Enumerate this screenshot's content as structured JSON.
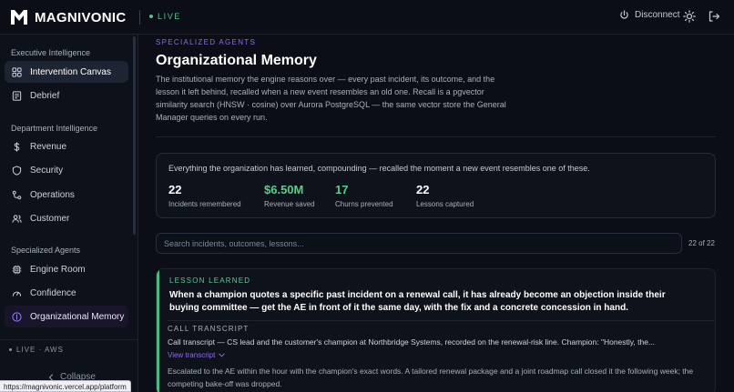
{
  "app": {
    "brand": "MAGNIVONIC",
    "live_label": "LIVE"
  },
  "header": {
    "disconnect_label": "Disconnect"
  },
  "sidebar": {
    "groups": [
      {
        "label": "Executive Intelligence",
        "items": [
          "Intervention Canvas",
          "Debrief"
        ]
      },
      {
        "label": "Department Intelligence",
        "items": [
          "Revenue",
          "Security",
          "Operations",
          "Customer"
        ]
      },
      {
        "label": "Specialized Agents",
        "items": [
          "Engine Room",
          "Confidence",
          "Organizational Memory"
        ]
      }
    ],
    "footer_live": "LIVE · AWS",
    "collapse_label": "Collapse"
  },
  "status_url": "https://magnivonic.vercel.app/platform",
  "page": {
    "eyebrow": "SPECIALIZED AGENTS",
    "title": "Organizational Memory",
    "description": "The institutional memory the engine reasons over — every past incident, its outcome, and the lesson it left behind, recalled when a new event resembles an old one. Recall is a pgvector similarity search (HNSW · cosine) over Aurora PostgreSQL — the same vector store the General Manager queries on every run."
  },
  "stats": {
    "caption": "Everything the organization has learned, compounding — recalled the moment a new event resembles one of these.",
    "items": [
      {
        "value": "22",
        "label": "Incidents remembered"
      },
      {
        "value": "$6.50M",
        "label": "Revenue saved"
      },
      {
        "value": "17",
        "label": "Churns prevented"
      },
      {
        "value": "22",
        "label": "Lessons captured"
      }
    ]
  },
  "search": {
    "placeholder": "Search incidents, outcomes, lessons...",
    "count": "22 of 22"
  },
  "lesson": {
    "tag": "LESSON LEARNED",
    "text": "When a champion quotes a specific past incident on a renewal call, it has already become an objection inside their buying committee — get the AE in front of it the same day, with the fix and a concrete concession in hand.",
    "call_tag": "CALL TRANSCRIPT",
    "call_text": "Call transcript — CS lead and the customer's champion at Northbridge Systems, recorded on the renewal-risk line. Champion: \"Honestly, the...",
    "view_label": "View transcript",
    "outcome": "Escalated to the AE within the hour with the champion's exact words. A tailored renewal package and a joint roadmap call closed it the following week; the competing bake-off was dropped."
  },
  "colors": {
    "accent_purple": "#8d6fe0",
    "accent_green": "#5fcc8d",
    "background": "#0b0e16"
  }
}
